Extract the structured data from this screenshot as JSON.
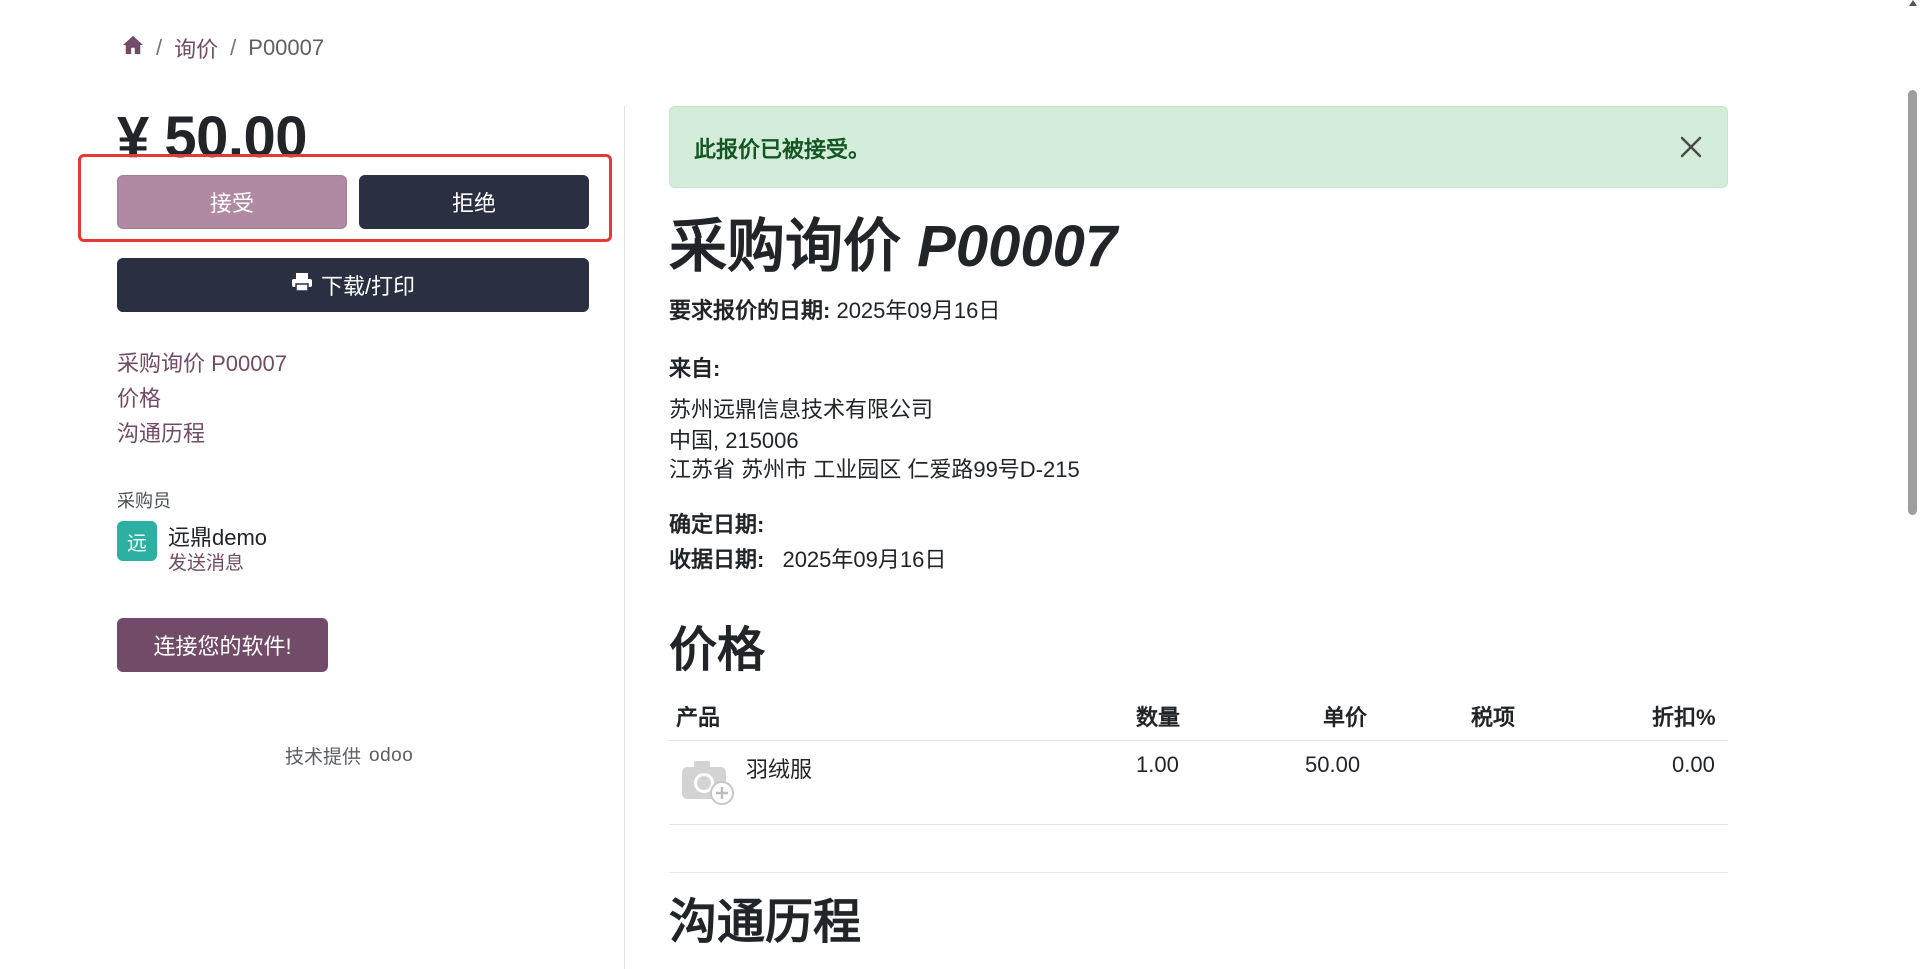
{
  "breadcrumb": {
    "home_icon": "home-icon",
    "sep": "/",
    "items": [
      "询价",
      "P00007"
    ]
  },
  "sidebar": {
    "amount": "¥ 50.00",
    "accept_label": "接受",
    "decline_label": "拒绝",
    "print_label": "下载/打印",
    "print_icon": "printer-icon",
    "nav": [
      "采购询价 P00007",
      "价格",
      "沟通历程"
    ],
    "buyer_label": "采购员",
    "buyer_avatar": "远",
    "buyer_name": "远鼎demo",
    "send_message": "发送消息",
    "connect_label": "连接您的软件!",
    "powered_by": "技术提供",
    "odoo_logo": "odoo"
  },
  "alert": {
    "message": "此报价已被接受。",
    "close_icon": "close-icon",
    "color": "#d4edda"
  },
  "document": {
    "title_prefix": "采购询价",
    "title_number": "P00007",
    "request_date_label": "要求报价的日期:",
    "request_date": "2025年09月16日",
    "from_label": "来自:",
    "address": [
      "苏州远鼎信息技术有限公司",
      "中国, 215006",
      "江苏省 苏州市 工业园区 仁爱路99号D-215"
    ],
    "confirm_date_label": "确定日期:",
    "receipt_date_label": "收据日期:",
    "receipt_date": "2025年09月16日",
    "pricing_heading": "价格",
    "history_heading": "沟通历程"
  },
  "table": {
    "headers": [
      "产品",
      "数量",
      "单价",
      "税项",
      "折扣%"
    ],
    "rows": [
      {
        "product": "羽绒服",
        "image_icon": "camera-placeholder-icon",
        "qty": "1.00",
        "unit_price": "50.00",
        "tax": "",
        "discount": "0.00"
      }
    ]
  },
  "colors": {
    "brand": "#714b67",
    "dark_button": "#2b2f42",
    "accept_button": "#b08aa3",
    "highlight": "#e53935"
  }
}
